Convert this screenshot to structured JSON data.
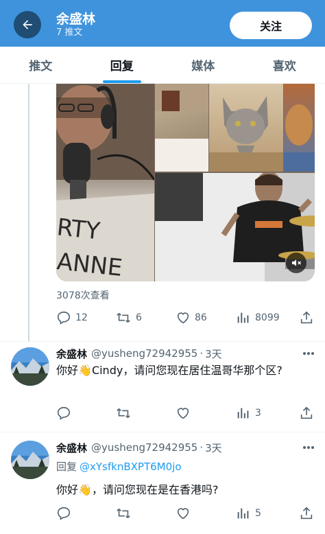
{
  "header": {
    "name": "余盛林",
    "subtitle": "7 推文",
    "follow_label": "关注",
    "colors": {
      "bar": "#3f93dc",
      "back_button": "#1f4d73"
    }
  },
  "tabs": [
    {
      "label": "推文",
      "active": false
    },
    {
      "label": "回复",
      "active": true
    },
    {
      "label": "媒体",
      "active": false
    },
    {
      "label": "喜欢",
      "active": false
    }
  ],
  "media_post": {
    "views": "3078次查看",
    "actions": {
      "replies": "12",
      "retweets": "6",
      "likes": "86",
      "view_count": "8099"
    },
    "mute_icon": "speaker-muted-icon"
  },
  "replies": [
    {
      "name": "余盛林",
      "handle": "@yusheng72942955",
      "separator": "·",
      "time": "3天",
      "reply_to_prefix": "",
      "reply_to": "",
      "text_before_emoji": "你好",
      "emoji": "👋",
      "text_after_emoji": "Cindy，请问您现在居住温哥华那个区?",
      "actions": {
        "replies": "",
        "retweets": "",
        "likes": "",
        "view_count": "3"
      }
    },
    {
      "name": "余盛林",
      "handle": "@yusheng72942955",
      "separator": "·",
      "time": "3天",
      "reply_to_prefix": "回复",
      "reply_to": "@xYsfknBXPT6M0jo",
      "text_before_emoji": "你好",
      "emoji": "👋",
      "text_after_emoji": "，请问您现在是在香港吗?",
      "actions": {
        "replies": "",
        "retweets": "",
        "likes": "",
        "view_count": "5"
      }
    }
  ],
  "colors": {
    "accent": "#1d9bf0",
    "secondary_text": "#536471",
    "primary_text": "#0f1419"
  }
}
